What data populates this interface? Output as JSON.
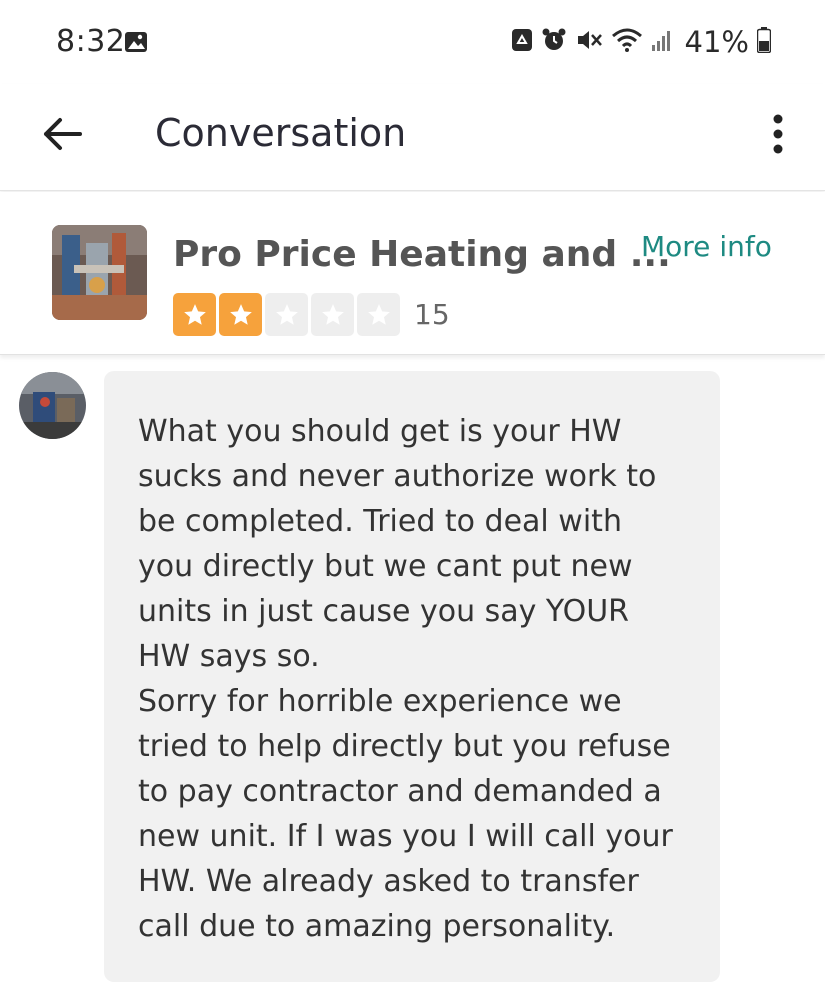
{
  "status_bar": {
    "time": "8:32",
    "battery": "41%",
    "icons": [
      "gallery-icon",
      "recycle-icon",
      "alarm-icon",
      "mute-icon",
      "wifi-icon",
      "signal-icon",
      "battery-icon"
    ]
  },
  "app_bar": {
    "title": "Conversation",
    "icons": [
      "back-arrow-icon",
      "more-vertical-icon"
    ]
  },
  "business": {
    "name": "Pro Price Heating and ...",
    "more_info": "More info",
    "rating": 2,
    "rating_max": 5,
    "review_count": "15",
    "colors": {
      "star_on": "#f6a23c",
      "link": "#1e8a82"
    }
  },
  "message": {
    "text": "What you should get is your HW\nsucks and never authorize work to\nbe completed. Tried to deal with\nyou directly but we cant put new\nunits in just cause you say YOUR\nHW says so.\nSorry for horrible experience we\ntried to help directly but you refuse\nto pay contractor and demanded a\nnew unit. If I was you I will call your\nHW. We already asked to transfer\ncall due to amazing personality."
  }
}
